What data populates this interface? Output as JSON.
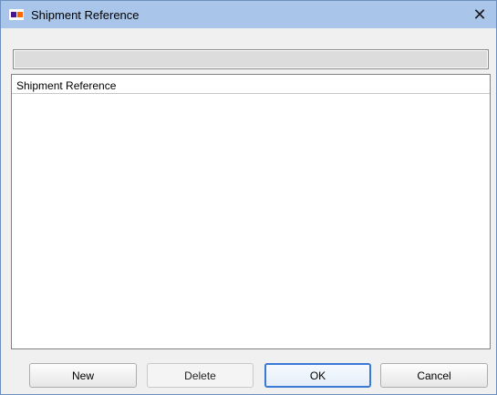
{
  "window": {
    "title": "Shipment Reference",
    "close_glyph": "✕",
    "icon": "fedex-logo-icon"
  },
  "reference_field": {
    "value": ""
  },
  "list": {
    "column_header": "Shipment Reference",
    "items": []
  },
  "buttons": {
    "new_label": "New",
    "delete_label": "Delete",
    "ok_label": "OK",
    "cancel_label": "Cancel"
  },
  "colors": {
    "titlebar": "#a9c6ea",
    "focus_border": "#3a7ad6",
    "brand_purple": "#4d148c",
    "brand_orange": "#ff6600"
  }
}
